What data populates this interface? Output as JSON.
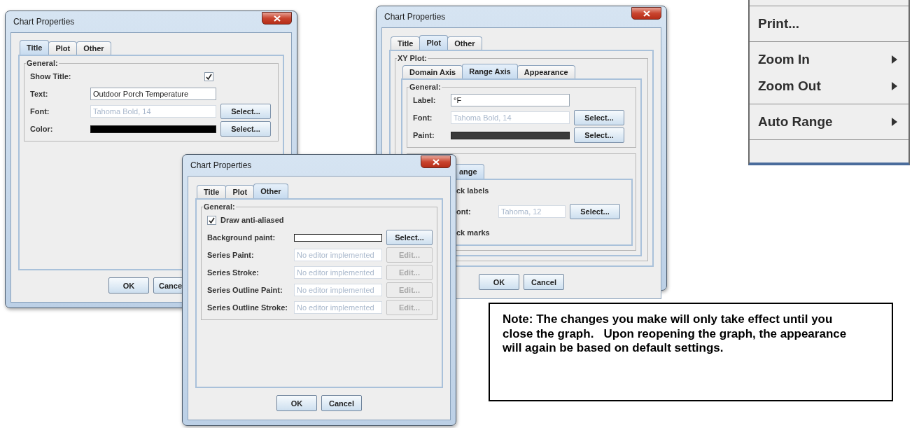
{
  "dialogs": [
    {
      "title": "Chart Properties",
      "tabs": [
        {
          "label": "Title",
          "selected": true
        },
        {
          "label": "Plot",
          "selected": false
        },
        {
          "label": "Other",
          "selected": false
        }
      ],
      "sections": [
        {
          "title": "General:",
          "rows": [
            {
              "kind": "check_right",
              "label": "Show Title:",
              "checked": true
            },
            {
              "kind": "field",
              "label": "Text:",
              "value": "Outdoor Porch Temperature",
              "disabled": false
            },
            {
              "kind": "field",
              "label": "Font:",
              "value": "Tahoma Bold, 14",
              "disabled": true,
              "button": {
                "label": "Select...",
                "disabled": false
              }
            },
            {
              "kind": "swatch",
              "label": "Color:",
              "color": "#000000",
              "button": {
                "label": "Select...",
                "disabled": false
              }
            }
          ]
        }
      ],
      "buttons": [
        "OK",
        "Cance"
      ]
    },
    {
      "title": "Chart Properties",
      "tabs": [
        {
          "label": "Title",
          "selected": false
        },
        {
          "label": "Plot",
          "selected": true
        },
        {
          "label": "Other",
          "selected": false
        }
      ],
      "sections": [
        {
          "title": "XY Plot:",
          "tabs": [
            {
              "label": "Domain Axis",
              "selected": false
            },
            {
              "label": "Range Axis",
              "selected": true
            },
            {
              "label": "Appearance",
              "selected": false
            }
          ],
          "children": [
            {
              "title": "General:",
              "rows": [
                {
                  "kind": "field",
                  "label": "Label:",
                  "value": "°F",
                  "disabled": false
                },
                {
                  "kind": "field",
                  "label": "Font:",
                  "value": "Tahoma Bold, 14",
                  "disabled": true,
                  "button": {
                    "label": "Select...",
                    "disabled": false
                  }
                },
                {
                  "kind": "swatch",
                  "label": "Paint:",
                  "color": "#3a3a3a",
                  "button": {
                    "label": "Select...",
                    "disabled": false
                  }
                }
              ]
            },
            {
              "tabs": [
                {
                  "label": "ange",
                  "selected": true
                }
              ],
              "rows": [
                {
                  "kind": "text",
                  "label": "ck labels"
                },
                {
                  "kind": "field",
                  "label": "ont:",
                  "value": "Tahoma, 12",
                  "disabled": true,
                  "button": {
                    "label": "Select...",
                    "disabled": false
                  }
                },
                {
                  "kind": "text",
                  "label": "ck marks"
                }
              ]
            }
          ]
        }
      ],
      "buttons": [
        "OK",
        "Cancel"
      ]
    },
    {
      "title": "Chart Properties",
      "tabs": [
        {
          "label": "Title",
          "selected": false
        },
        {
          "label": "Plot",
          "selected": false
        },
        {
          "label": "Other",
          "selected": true
        }
      ],
      "sections": [
        {
          "title": "General:",
          "rows": [
            {
              "kind": "checkbox",
              "label": "Draw anti-aliased",
              "checked": true
            },
            {
              "kind": "swatch",
              "label": "Background paint:",
              "color": "#ffffff",
              "button": {
                "label": "Select...",
                "disabled": false
              }
            },
            {
              "kind": "field",
              "label": "Series Paint:",
              "value": "No editor implemented",
              "disabled": true,
              "button": {
                "label": "Edit...",
                "disabled": true
              }
            },
            {
              "kind": "field",
              "label": "Series Stroke:",
              "value": "No editor implemented",
              "disabled": true,
              "button": {
                "label": "Edit...",
                "disabled": true
              }
            },
            {
              "kind": "field",
              "label": "Series Outline Paint:",
              "value": "No editor implemented",
              "disabled": true,
              "button": {
                "label": "Edit...",
                "disabled": true
              }
            },
            {
              "kind": "field",
              "label": "Series Outline Stroke:",
              "value": "No editor implemented",
              "disabled": true,
              "button": {
                "label": "Edit...",
                "disabled": true
              }
            }
          ]
        }
      ],
      "buttons": [
        "OK",
        "Cancel"
      ]
    }
  ],
  "context_menu": {
    "groups": [
      [
        {
          "label": "Print...",
          "submenu": false
        }
      ],
      [
        {
          "label": "Zoom In",
          "submenu": true
        },
        {
          "label": "Zoom Out",
          "submenu": true
        }
      ],
      [
        {
          "label": "Auto Range",
          "submenu": true
        }
      ]
    ]
  },
  "note": "Note: The changes you make will only take effect until you close the graph.   Upon reopening the graph, the appearance will again be based on default settings."
}
